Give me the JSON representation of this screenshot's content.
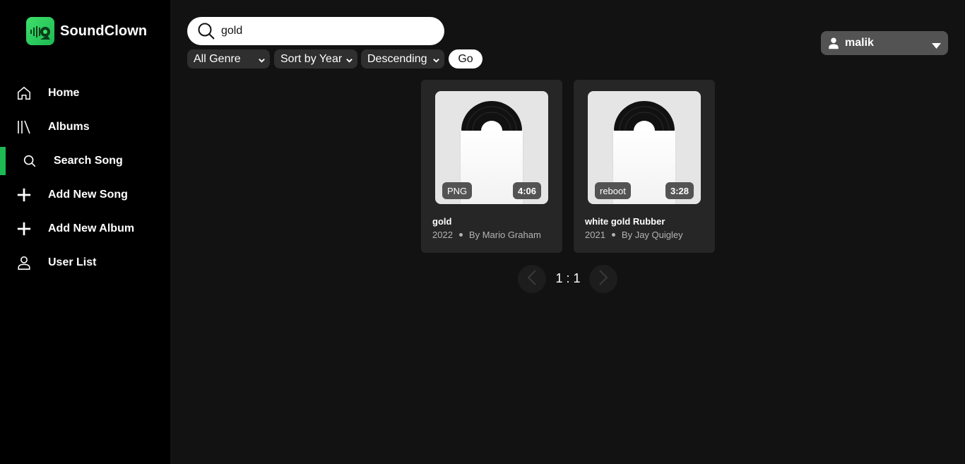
{
  "app": {
    "name": "SoundClown"
  },
  "sidebar": {
    "items": [
      {
        "label": "Home",
        "icon": "home-icon",
        "active": false
      },
      {
        "label": "Albums",
        "icon": "library-icon",
        "active": false
      },
      {
        "label": "Search Song",
        "icon": "search-icon",
        "active": true
      },
      {
        "label": "Add New Song",
        "icon": "plus-icon",
        "active": false
      },
      {
        "label": "Add New Album",
        "icon": "plus-icon",
        "active": false
      },
      {
        "label": "User List",
        "icon": "user-icon",
        "active": false
      }
    ]
  },
  "search": {
    "value": "gold",
    "placeholder": ""
  },
  "filters": {
    "genre": "All Genre",
    "sort": "Sort by Year",
    "order": "Descending",
    "go_label": "Go"
  },
  "user": {
    "name": "malik"
  },
  "results": [
    {
      "title": "gold",
      "year": "2022",
      "artist": "By Mario Graham",
      "tag": "PNG",
      "duration": "4:06"
    },
    {
      "title": "white gold Rubber",
      "year": "2021",
      "artist": "By Jay Quigley",
      "tag": "reboot",
      "duration": "3:28"
    }
  ],
  "pagination": {
    "label": "1 : 1"
  },
  "colors": {
    "accent": "#1db954",
    "background": "#121212",
    "sidebar": "#000000"
  }
}
